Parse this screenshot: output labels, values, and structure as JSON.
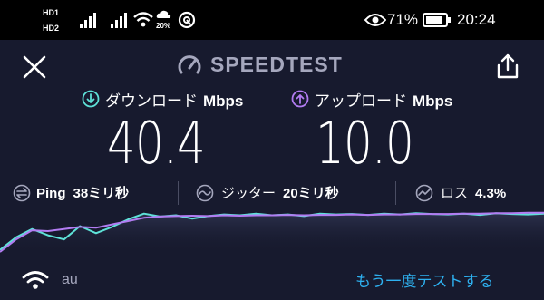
{
  "status_bar": {
    "sim1": "HD1",
    "sim2": "HD2",
    "wifi_speed": "20%",
    "battery_percent": "71%",
    "time": "20:24",
    "icons": [
      "signal-icon",
      "wifi-icon",
      "speedometer-icon",
      "eye-icon",
      "battery-icon"
    ]
  },
  "header": {
    "title": "SPEEDTEST",
    "close_icon": "close-icon",
    "share_icon": "share-icon"
  },
  "download": {
    "label": "ダウンロード",
    "unit": "Mbps",
    "value": "40.4",
    "color": "#5ee2d8"
  },
  "upload": {
    "label": "アップロード",
    "unit": "Mbps",
    "value": "10.0",
    "color": "#b27cf2"
  },
  "metrics": {
    "ping": {
      "label": "Ping",
      "value": "38ミリ秒"
    },
    "jitter": {
      "label": "ジッター",
      "value": "20ミリ秒"
    },
    "loss": {
      "label": "ロス",
      "value": "4.3%"
    }
  },
  "chart_data": {
    "type": "line",
    "series": [
      {
        "values": [
          0.05,
          0.35,
          0.55,
          0.4,
          0.3,
          0.62,
          0.45,
          0.6,
          0.78,
          0.92,
          0.85,
          0.88,
          0.8,
          0.86,
          0.9,
          0.88,
          0.92,
          0.88,
          0.9,
          0.86,
          0.92,
          0.9,
          0.91,
          0.89,
          0.92,
          0.9,
          0.93,
          0.91,
          0.9,
          0.92,
          0.89,
          0.93,
          0.91,
          0.9,
          0.92
        ]
      },
      {
        "values": [
          0.0,
          0.3,
          0.52,
          0.5,
          0.55,
          0.6,
          0.58,
          0.66,
          0.74,
          0.82,
          0.85,
          0.86,
          0.87,
          0.86,
          0.88,
          0.87,
          0.88,
          0.88,
          0.89,
          0.88,
          0.89,
          0.89,
          0.9,
          0.89,
          0.9,
          0.9,
          0.91,
          0.91,
          0.91,
          0.92,
          0.92,
          0.93,
          0.93,
          0.94,
          0.94
        ]
      }
    ],
    "colors": [
      "#5ee2d8",
      "#b27cf2"
    ]
  },
  "footer": {
    "carrier": "au",
    "retest": "もう一度テストする"
  },
  "colors": {
    "background": "#171a2e",
    "muted": "#a5a7bd",
    "link": "#2eb1f0"
  }
}
